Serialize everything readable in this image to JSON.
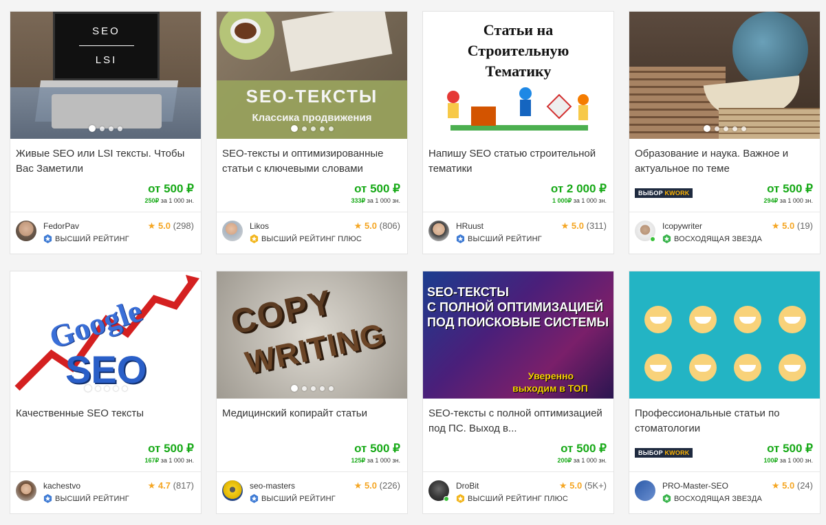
{
  "cards": [
    {
      "title": "Живые SEO или LSI тексты. Чтобы Вас Заметили",
      "price": "от 500 ₽",
      "per_price": "250₽",
      "per_unit": " за 1 000 зн.",
      "user": "FedorPav",
      "rating": "5.0",
      "reviews": "(298)",
      "level": "ВЫСШИЙ РЕЙТИНГ",
      "badge": false,
      "online": false,
      "thumb_text": [
        "SEO",
        "LSI"
      ]
    },
    {
      "title": "SEO-тексты и оптимизированные статьи с ключевыми словами",
      "price": "от 500 ₽",
      "per_price": "333₽",
      "per_unit": " за 1 000 зн.",
      "user": "Likos",
      "rating": "5.0",
      "reviews": "(806)",
      "level": "ВЫСШИЙ РЕЙТИНГ ПЛЮС",
      "badge": false,
      "online": false,
      "thumb_text": [
        "SEO-ТЕКСТЫ",
        "Классика продвижения"
      ]
    },
    {
      "title": "Напишу SEO статью строительной тематики",
      "price": "от 2 000 ₽",
      "per_price": "1 000₽",
      "per_unit": " за 1 000 зн.",
      "user": "HRuust",
      "rating": "5.0",
      "reviews": "(311)",
      "level": "ВЫСШИЙ РЕЙТИНГ",
      "badge": false,
      "online": false,
      "thumb_text": [
        "Статьи на",
        "Строительную",
        "Тематику"
      ]
    },
    {
      "title": "Образование и наука. Важное и актуальное по теме",
      "price": "от 500 ₽",
      "per_price": "294₽",
      "per_unit": " за 1 000 зн.",
      "user": "Icopywriter",
      "rating": "5.0",
      "reviews": "(19)",
      "level": "ВОСХОДЯЩАЯ ЗВЕЗДА",
      "badge": true,
      "online": true,
      "thumb_text": []
    },
    {
      "title": "Качественные SEO тексты",
      "price": "от 500 ₽",
      "per_price": "167₽",
      "per_unit": " за 1 000 зн.",
      "user": "kachestvo",
      "rating": "4.7",
      "reviews": "(817)",
      "level": "ВЫСШИЙ РЕЙТИНГ",
      "badge": false,
      "online": false,
      "thumb_text": [
        "Google",
        "SEO"
      ]
    },
    {
      "title": "Медицинский копирайт статьи",
      "price": "от 500 ₽",
      "per_price": "125₽",
      "per_unit": " за 1 000 зн.",
      "user": "seo-masters",
      "rating": "5.0",
      "reviews": "(226)",
      "level": "ВЫСШИЙ РЕЙТИНГ",
      "badge": false,
      "online": false,
      "thumb_text": [
        "COPY",
        "WRITING"
      ]
    },
    {
      "title": "SEO-тексты с полной оптимизацией под ПС. Выход в...",
      "price": "от 500 ₽",
      "per_price": "200₽",
      "per_unit": " за 1 000 зн.",
      "user": "DroBit",
      "rating": "5.0",
      "reviews": "(5K+)",
      "level": "ВЫСШИЙ РЕЙТИНГ ПЛЮС",
      "badge": false,
      "online": true,
      "thumb_text": [
        "SEO-ТЕКСТЫ",
        "С ПОЛНОЙ ОПТИМИЗАЦИЕЙ",
        "ПОД ПОИСКОВЫЕ СИСТЕМЫ",
        "Уверенно",
        "выходим в ТОП"
      ]
    },
    {
      "title": "Профессиональные статьи по стоматологии",
      "price": "от 500 ₽",
      "per_price": "100₽",
      "per_unit": " за 1 000 зн.",
      "user": "PRO-Master-SEO",
      "rating": "5.0",
      "reviews": "(24)",
      "level": "ВОСХОДЯЩАЯ ЗВЕЗДА",
      "badge": true,
      "online": false,
      "thumb_text": []
    }
  ],
  "badge": {
    "prefix": "ВЫБОР ",
    "brand": "KWORK"
  },
  "colors": {
    "price": "#17a917",
    "star": "#f5a623",
    "badge_bg": "#1e2a3f"
  }
}
